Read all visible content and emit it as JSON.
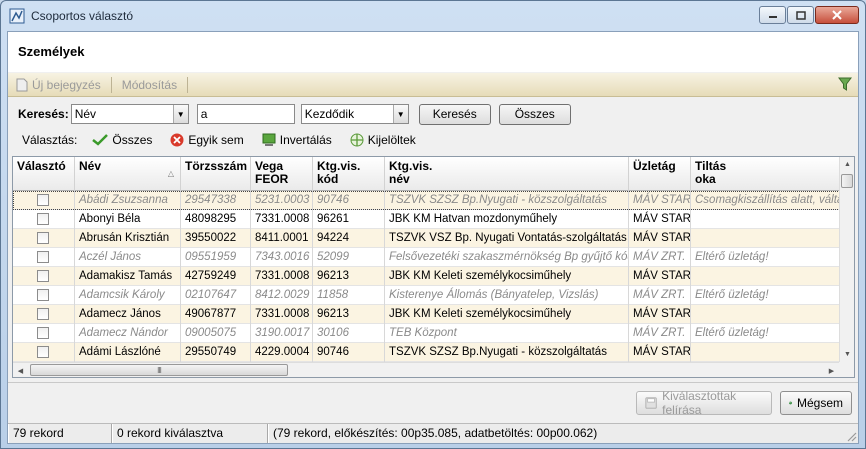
{
  "window": {
    "title": "Csoportos választó"
  },
  "page": {
    "title": "Személyek"
  },
  "toolbar": {
    "new_label": "Új bejegyzés",
    "edit_label": "Módosítás"
  },
  "search": {
    "label": "Keresés:",
    "field_value": "Név",
    "text_value": "a",
    "mode_value": "Kezdődik",
    "search_button": "Keresés",
    "all_button": "Összes"
  },
  "selection": {
    "label": "Választás:",
    "all": "Összes",
    "none": "Egyik sem",
    "invert": "Invertálás",
    "selected": "Kijelöltek"
  },
  "grid": {
    "columns": [
      {
        "label": "Választó"
      },
      {
        "label": "Név"
      },
      {
        "label": "Törzsszám"
      },
      {
        "label": "Vega\nFEOR"
      },
      {
        "label": "Ktg.vis.\nkód"
      },
      {
        "label": "Ktg.vis.\nnév"
      },
      {
        "label": "Üzletág"
      },
      {
        "label": "Tiltás\noka"
      }
    ],
    "rows": [
      {
        "name": "Abádi Zsuzsanna",
        "id": "29547338",
        "feor": "5231.0003",
        "code": "90746",
        "costname": "TSZVK SZSZ Bp.Nyugati - közszolgáltatás",
        "branch": "MÁV START",
        "reason": "Csomagkiszállítás alatt, váltás",
        "inactive": true
      },
      {
        "name": "Abonyi Béla",
        "id": "48098295",
        "feor": "7331.0008",
        "code": "96261",
        "costname": "JBK KM Hatvan mozdonyműhely",
        "branch": "MÁV START",
        "reason": "",
        "inactive": false
      },
      {
        "name": "Abrusán Krisztián",
        "id": "39550022",
        "feor": "8411.0001",
        "code": "94224",
        "costname": "TSZVK VSZ  Bp. Nyugati Vontatás-szolgáltatás",
        "branch": "MÁV START",
        "reason": "",
        "inactive": false
      },
      {
        "name": "Aczél János",
        "id": "09551959",
        "feor": "7343.0016",
        "code": "52099",
        "costname": "Felsővezetéki szakaszmérnökség Bp gyűjtő kód",
        "branch": "MÁV ZRT.",
        "reason": "Eltérő üzletág!",
        "inactive": true
      },
      {
        "name": "Adamakisz Tamás",
        "id": "42759249",
        "feor": "7331.0008",
        "code": "96213",
        "costname": "JBK KM Keleti személykocsiműhely",
        "branch": "MÁV START",
        "reason": "",
        "inactive": false
      },
      {
        "name": "Adamcsik Károly",
        "id": "02107647",
        "feor": "8412.0029",
        "code": "11858",
        "costname": "Kisterenye Állomás (Bányatelep, Vizslás)",
        "branch": "MÁV ZRT.",
        "reason": "Eltérő üzletág!",
        "inactive": true
      },
      {
        "name": "Adamecz János",
        "id": "49067877",
        "feor": "7331.0008",
        "code": "96213",
        "costname": "JBK KM Keleti személykocsiműhely",
        "branch": "MÁV START",
        "reason": "",
        "inactive": false
      },
      {
        "name": "Adamecz Nándor",
        "id": "09005075",
        "feor": "3190.0017",
        "code": "30106",
        "costname": "TEB Központ",
        "branch": "MÁV ZRT.",
        "reason": "Eltérő üzletág!",
        "inactive": true
      },
      {
        "name": "Adámi Lászlóné",
        "id": "29550749",
        "feor": "4229.0004",
        "code": "90746",
        "costname": "TSZVK SZSZ Bp.Nyugati - közszolgáltatás",
        "branch": "MÁV START",
        "reason": "",
        "inactive": false
      }
    ],
    "hscroll_grip": "III"
  },
  "buttons": {
    "write_selected": "Kiválasztottak felírása",
    "cancel": "Mégsem"
  },
  "status": {
    "records": "79 rekord",
    "selected": "0 rekord kiválasztva",
    "timing": "(79 rekord, előkészítés: 00p35.085, adatbetöltés: 00p00.062)"
  }
}
